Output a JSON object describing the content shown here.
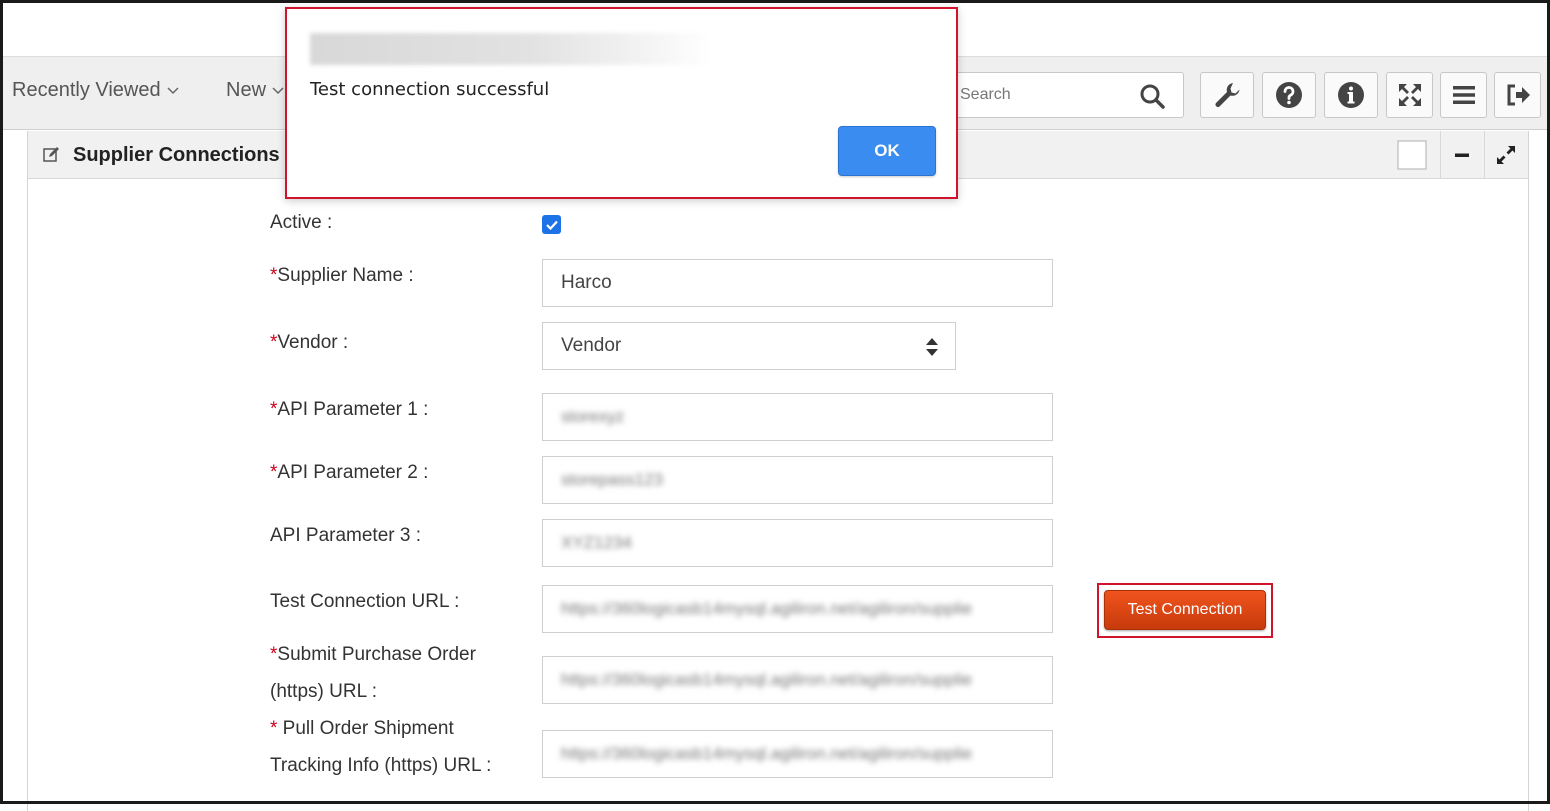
{
  "toolbar": {
    "recently_viewed": "Recently Viewed",
    "new": "New",
    "search_placeholder": "Search",
    "tool_icons": [
      "wrench-icon",
      "help-icon",
      "info-icon",
      "fullscreen-icon",
      "menu-icon",
      "logout-icon"
    ]
  },
  "panel": {
    "title": "Supplier Connections"
  },
  "form": {
    "active_label": "Active :",
    "active_checked": true,
    "supplier_name_label": "Supplier Name :",
    "supplier_name_value": "Harco",
    "vendor_label": "Vendor :",
    "vendor_value": "Vendor",
    "api1_label": "API Parameter 1 :",
    "api1_value": "storexyz",
    "api2_label": "API Parameter 2 :",
    "api2_value": "storepass123",
    "api3_label": "API Parameter 3 :",
    "api3_value": "XYZ1234",
    "test_url_label": "Test Connection URL :",
    "test_url_value": "https://360logicasb14mysql.agiliron.net/agiliron/supplie",
    "submit_po_label_line1": "Submit Purchase Order",
    "submit_po_label_line2": "(https) URL :",
    "submit_po_value": "https://360logicasb14mysql.agiliron.net/agiliron/supplie",
    "pull_order_label_line1": " Pull Order Shipment",
    "pull_order_label_line2": "Tracking Info (https) URL :",
    "pull_order_value": "https://360logicasb14mysql.agiliron.net/agiliron/supplie",
    "required_mark": "*",
    "test_button": "Test Connection"
  },
  "dialog": {
    "message": "Test connection successful",
    "ok": "OK"
  },
  "colors": {
    "accent_orange": "#e04a16",
    "ok_blue": "#3b8cf0",
    "highlight_red": "#d0142c",
    "checkbox_blue": "#1d72e8"
  }
}
